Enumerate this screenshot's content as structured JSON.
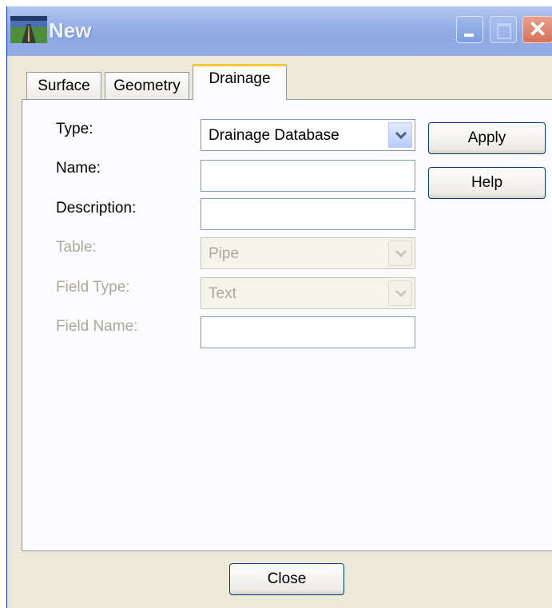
{
  "window": {
    "title": "New"
  },
  "tabs": [
    {
      "label": "Surface"
    },
    {
      "label": "Geometry"
    },
    {
      "label": "Drainage"
    }
  ],
  "form": {
    "type": {
      "label": "Type:",
      "value": "Drainage Database"
    },
    "name": {
      "label": "Name:",
      "value": ""
    },
    "description": {
      "label": "Description:",
      "value": ""
    },
    "table": {
      "label": "Table:",
      "value": "Pipe"
    },
    "field_type": {
      "label": "Field Type:",
      "value": "Text"
    },
    "field_name": {
      "label": "Field Name:",
      "value": ""
    }
  },
  "buttons": {
    "apply": "Apply",
    "help": "Help",
    "close": "Close"
  },
  "icons": {
    "app": "road-icon",
    "minimize": "minimize-icon",
    "maximize": "maximize-icon",
    "close": "close-icon",
    "dropdown": "chevron-down-icon"
  },
  "colors": {
    "tab_highlight": "#ffc83c",
    "close_button": "#d7725b",
    "title_bar": "#9db5ea"
  }
}
